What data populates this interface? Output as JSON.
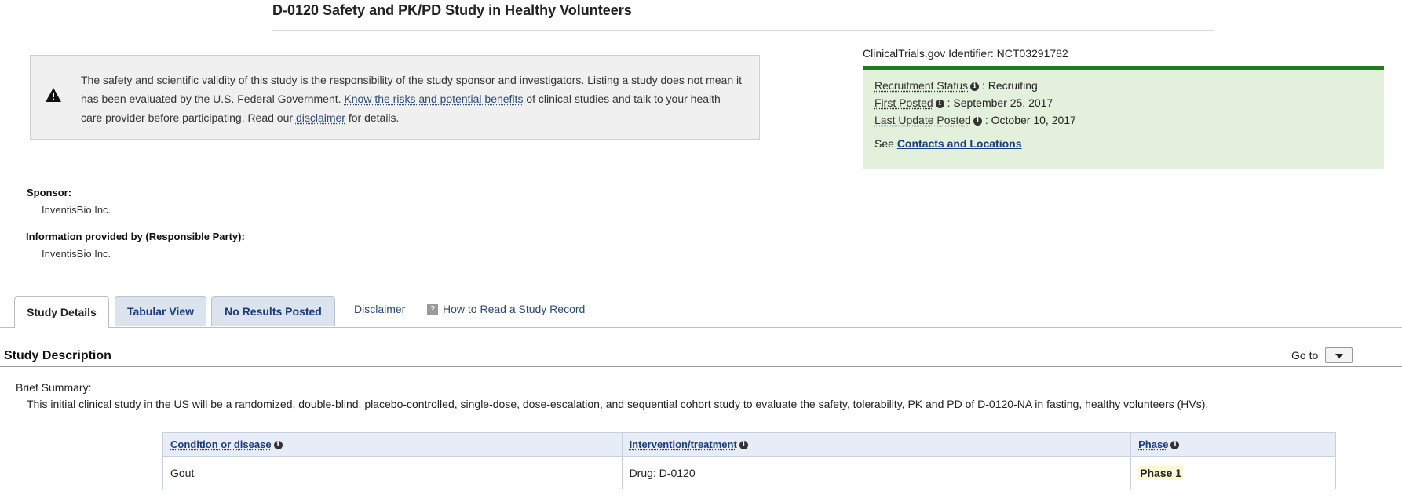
{
  "title": "D-0120 Safety and PK/PD Study in Healthy Volunteers",
  "disclaimer": {
    "text_1": "The safety and scientific validity of this study is the responsibility of the study sponsor and investigators. Listing a study does not mean it has been evaluated by the U.S. Federal Government.",
    "link_risks": "Know the risks and potential benefits",
    "text_2": "of clinical studies and talk to your health care provider before participating. Read our",
    "link_disclaimer": "disclaimer",
    "text_3": "for details."
  },
  "identifier": {
    "label": "ClinicalTrials.gov Identifier:",
    "value": "NCT03291782"
  },
  "status": {
    "recruitment_label": "Recruitment Status",
    "recruitment_value": "Recruiting",
    "first_posted_label": "First Posted",
    "first_posted_value": "September 25, 2017",
    "last_update_label": "Last Update Posted",
    "last_update_value": "October 10, 2017",
    "see_label": "See",
    "contacts_link": "Contacts and Locations",
    "separator": ":"
  },
  "sponsor": {
    "label": "Sponsor:",
    "value": "InventisBio Inc."
  },
  "responsible_party": {
    "label": "Information provided by (Responsible Party):",
    "value": "InventisBio Inc."
  },
  "tabs": {
    "study_details": "Study Details",
    "tabular_view": "Tabular View",
    "no_results": "No Results Posted",
    "disclaimer": "Disclaimer",
    "how_to_read": "How to Read a Study Record"
  },
  "section": {
    "title": "Study Description",
    "goto_label": "Go to"
  },
  "brief_summary": {
    "label": "Brief Summary:",
    "text": "This initial clinical study in the US will be a randomized, double-blind, placebo-controlled, single-dose, dose-escalation, and sequential cohort study to evaluate the safety, tolerability, PK and PD of D-0120-NA in fasting, healthy volunteers (HVs)."
  },
  "conditions_table": {
    "headers": [
      "Condition or disease",
      "Intervention/treatment",
      "Phase"
    ],
    "rows": [
      [
        "Gout",
        "Drug: D-0120",
        "Phase 1"
      ]
    ]
  },
  "colors": {
    "status_bar": "#1e7c1e",
    "status_bg": "#e2f0dc",
    "link_blue": "#1a3d7c",
    "tab_bg": "#dbe3ef"
  },
  "icons": {
    "warning": "warning-triangle-icon",
    "info": "info-icon",
    "help": "question-mark-icon",
    "dropdown": "caret-down-icon"
  }
}
